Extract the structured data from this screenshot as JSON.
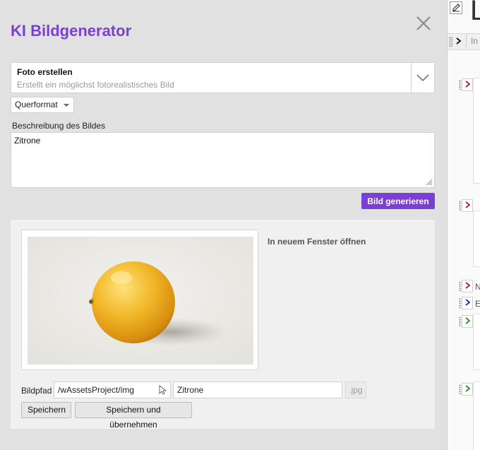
{
  "dialog": {
    "title": "KI Bildgenerator",
    "close_icon": "close-icon",
    "mode": {
      "title": "Foto erstellen",
      "description": "Erstellt ein möglichst fotorealistisches Bild"
    },
    "format": {
      "selected": "Querformat"
    },
    "description_label": "Beschreibung des Bildes",
    "description_value": "Zitrone",
    "generate_label": "Bild generieren",
    "accent_color": "#7b3fd4"
  },
  "result": {
    "image_subject": "lemon-photo",
    "open_in_new_window": "In neuem Fenster öffnen",
    "path_label": "Bildpfad",
    "path_value": "/wAssetsProject/img",
    "file_name": "Zitrone",
    "extension": ".jpg",
    "save_label": "Speichern",
    "save_apply_label": "Speichern und übernehmen"
  },
  "editor": {
    "big_letter": "L",
    "bar_text": "In",
    "side_texts": [
      "N",
      "E"
    ],
    "row_colors": {
      "red": "#b22222",
      "blue": "#1a2fb0",
      "green": "#2e8b2e"
    }
  }
}
